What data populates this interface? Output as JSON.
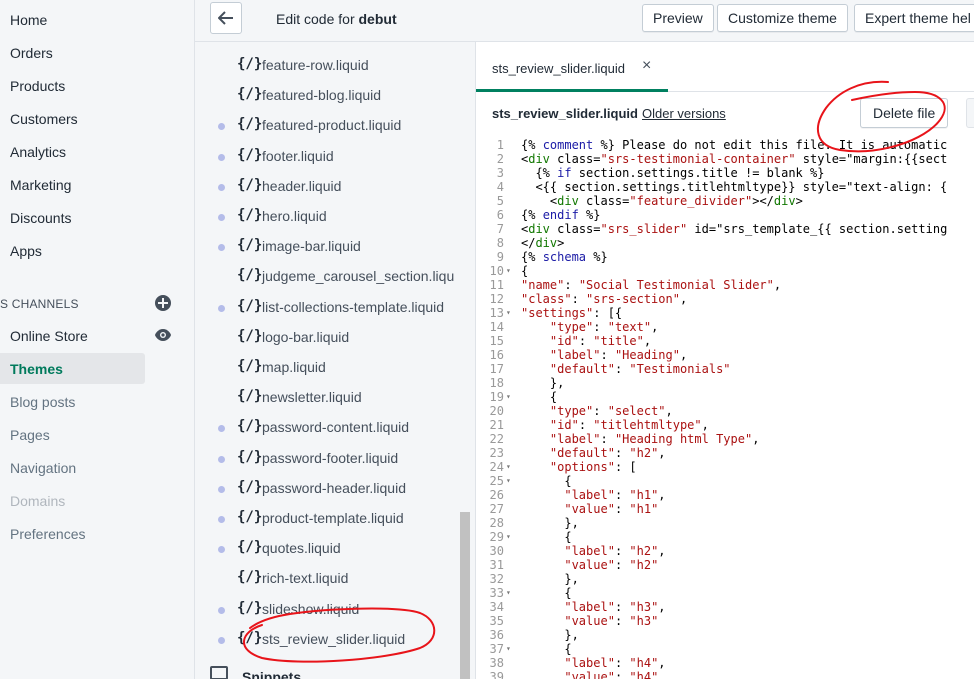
{
  "nav": {
    "items": [
      "Home",
      "Orders",
      "Products",
      "Customers",
      "Analytics",
      "Marketing",
      "Discounts",
      "Apps"
    ],
    "sales_channels_label": "S CHANNELS",
    "channel_items": [
      "Online Store"
    ],
    "sub_items": [
      "Themes",
      "Blog posts",
      "Pages",
      "Navigation",
      "Domains",
      "Preferences"
    ],
    "active_sub_item": "Themes",
    "disabled_sub_item": "Domains"
  },
  "topbar": {
    "title_prefix": "Edit code for",
    "theme_name": "debut",
    "preview_label": "Preview",
    "customize_label": "Customize theme",
    "expert_help_label": "Expert theme hel"
  },
  "file_tree": {
    "icon_text": "{/}",
    "files": [
      {
        "name": "feature-row.liquid",
        "dot": false
      },
      {
        "name": "featured-blog.liquid",
        "dot": false
      },
      {
        "name": "featured-product.liquid",
        "dot": true
      },
      {
        "name": "footer.liquid",
        "dot": true
      },
      {
        "name": "header.liquid",
        "dot": true
      },
      {
        "name": "hero.liquid",
        "dot": true
      },
      {
        "name": "image-bar.liquid",
        "dot": true
      },
      {
        "name": "judgeme_carousel_section.liqu",
        "dot": false
      },
      {
        "name": "list-collections-template.liquid",
        "dot": true
      },
      {
        "name": "logo-bar.liquid",
        "dot": false
      },
      {
        "name": "map.liquid",
        "dot": false
      },
      {
        "name": "newsletter.liquid",
        "dot": false
      },
      {
        "name": "password-content.liquid",
        "dot": true
      },
      {
        "name": "password-footer.liquid",
        "dot": true
      },
      {
        "name": "password-header.liquid",
        "dot": true
      },
      {
        "name": "product-template.liquid",
        "dot": true
      },
      {
        "name": "quotes.liquid",
        "dot": true
      },
      {
        "name": "rich-text.liquid",
        "dot": false
      },
      {
        "name": "slideshow.liquid",
        "dot": true
      },
      {
        "name": "sts_review_slider.liquid",
        "dot": true
      }
    ],
    "folder_label": "Snippets"
  },
  "editor": {
    "tab_label": "sts_review_slider.liquid",
    "tab_close": "×",
    "file_name": "sts_review_slider.liquid",
    "older_versions": "Older versions",
    "delete_label": "Delete file",
    "lines": [
      "{% comment %} Please do not edit this file. It is automatic",
      "<div class=\"srs-testimonial-container\" style=\"margin:{{sect",
      "  {% if section.settings.title != blank %}",
      "  <{{ section.settings.titlehtmltype}} style=\"text-align: {",
      "    <div class=\"feature_divider\"></div>",
      "{% endif %}",
      "<div class=\"srs_slider\" id=\"srs_template_{{ section.setting",
      "</div>",
      "{% schema %}",
      "{",
      "\"name\": \"Social Testimonial Slider\",",
      "\"class\": \"srs-section\",",
      "\"settings\": [{",
      "    \"type\": \"text\",",
      "    \"id\": \"title\",",
      "    \"label\": \"Heading\",",
      "    \"default\": \"Testimonials\"",
      "    },",
      "    {",
      "    \"type\": \"select\",",
      "    \"id\": \"titlehtmltype\",",
      "    \"label\": \"Heading html Type\",",
      "    \"default\": \"h2\",",
      "    \"options\": [",
      "      {",
      "      \"label\": \"h1\",",
      "      \"value\": \"h1\"",
      "      },",
      "      {",
      "      \"label\": \"h2\",",
      "      \"value\": \"h2\"",
      "      },",
      "      {",
      "      \"label\": \"h3\",",
      "      \"value\": \"h3\"",
      "      },",
      "      {",
      "      \"label\": \"h4\",",
      "      \"value\": \"h4\""
    ],
    "fold_lines": [
      10,
      13,
      19,
      24,
      25,
      29,
      33,
      37
    ]
  },
  "colors": {
    "accent": "#008060",
    "annotation": "#e8141a",
    "dot": "#b4bce9"
  }
}
